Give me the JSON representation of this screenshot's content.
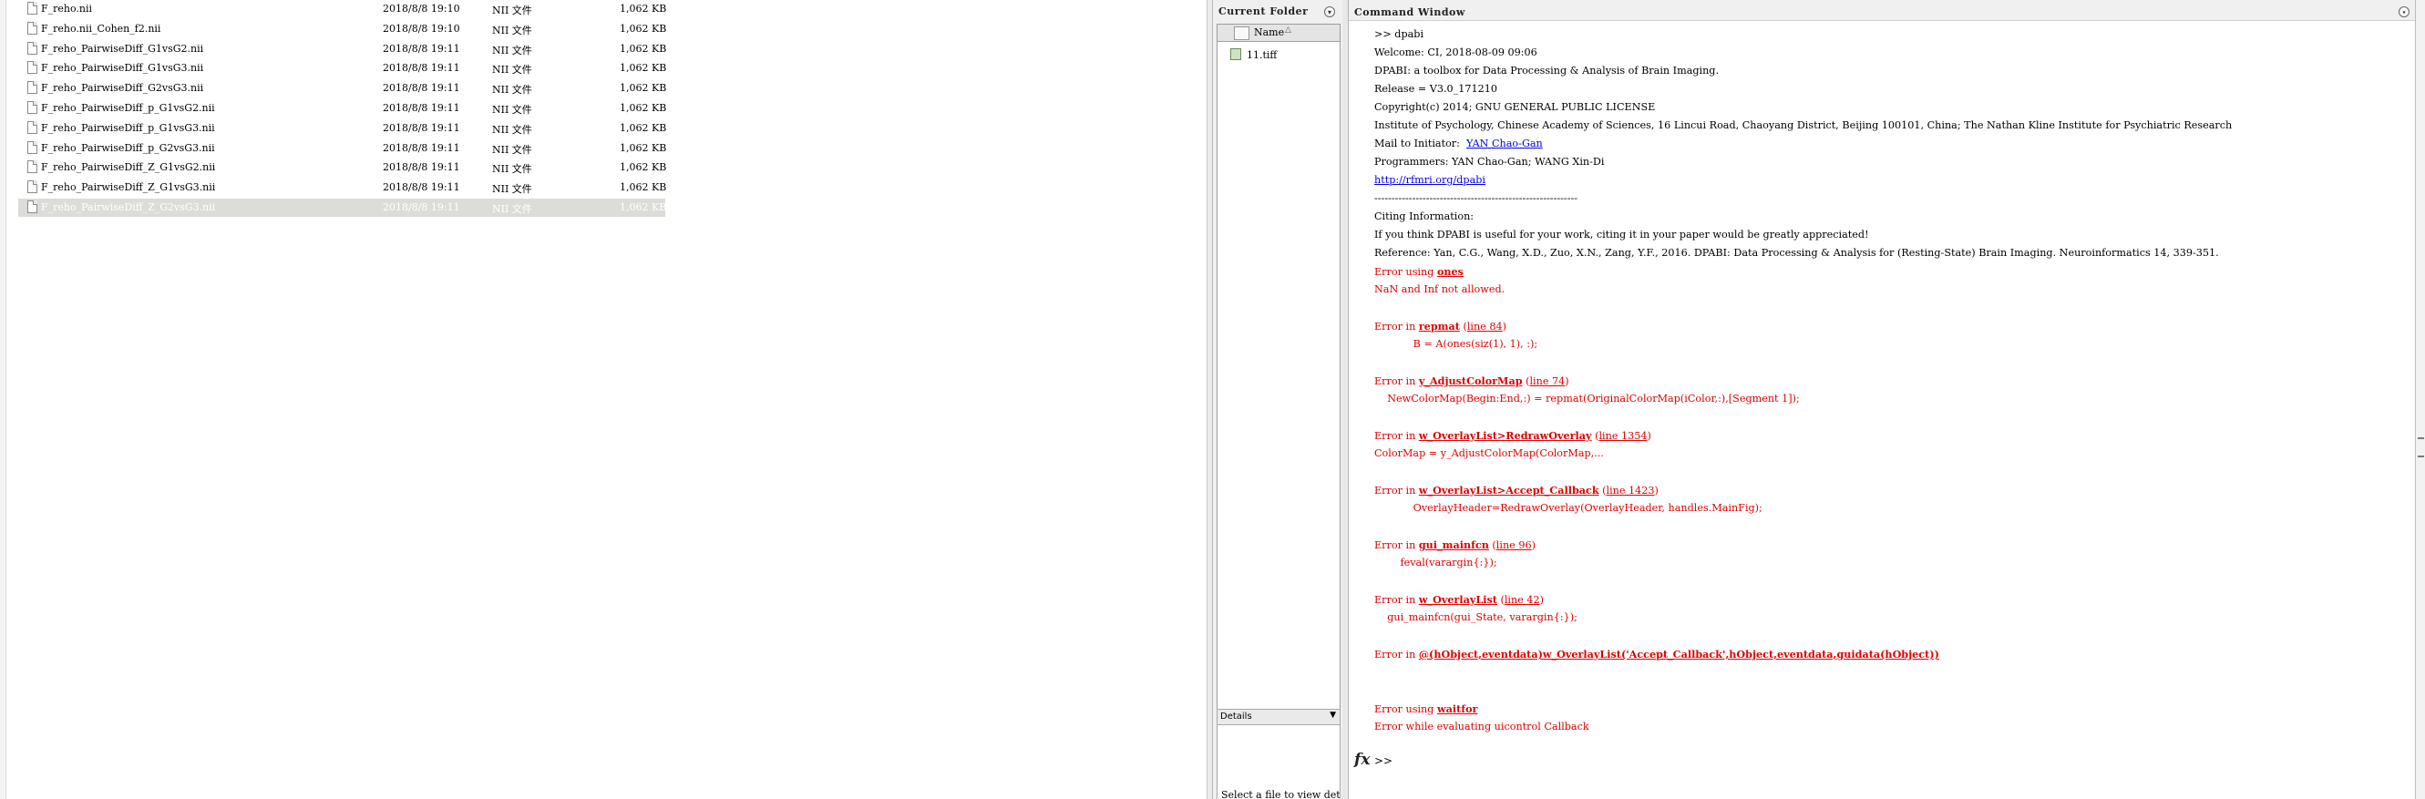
{
  "explorer": {
    "files": [
      {
        "name": "F_reho.nii",
        "date": "2018/8/8 19:10",
        "type": "NII 文件",
        "size": "1,062 KB",
        "selected": false
      },
      {
        "name": "F_reho.nii_Cohen_f2.nii",
        "date": "2018/8/8 19:10",
        "type": "NII 文件",
        "size": "1,062 KB",
        "selected": false
      },
      {
        "name": "F_reho_PairwiseDiff_G1vsG2.nii",
        "date": "2018/8/8 19:11",
        "type": "NII 文件",
        "size": "1,062 KB",
        "selected": false
      },
      {
        "name": "F_reho_PairwiseDiff_G1vsG3.nii",
        "date": "2018/8/8 19:11",
        "type": "NII 文件",
        "size": "1,062 KB",
        "selected": false
      },
      {
        "name": "F_reho_PairwiseDiff_G2vsG3.nii",
        "date": "2018/8/8 19:11",
        "type": "NII 文件",
        "size": "1,062 KB",
        "selected": false
      },
      {
        "name": "F_reho_PairwiseDiff_p_G1vsG2.nii",
        "date": "2018/8/8 19:11",
        "type": "NII 文件",
        "size": "1,062 KB",
        "selected": false
      },
      {
        "name": "F_reho_PairwiseDiff_p_G1vsG3.nii",
        "date": "2018/8/8 19:11",
        "type": "NII 文件",
        "size": "1,062 KB",
        "selected": false
      },
      {
        "name": "F_reho_PairwiseDiff_p_G2vsG3.nii",
        "date": "2018/8/8 19:11",
        "type": "NII 文件",
        "size": "1,062 KB",
        "selected": false
      },
      {
        "name": "F_reho_PairwiseDiff_Z_G1vsG2.nii",
        "date": "2018/8/8 19:11",
        "type": "NII 文件",
        "size": "1,062 KB",
        "selected": false
      },
      {
        "name": "F_reho_PairwiseDiff_Z_G1vsG3.nii",
        "date": "2018/8/8 19:11",
        "type": "NII 文件",
        "size": "1,062 KB",
        "selected": false
      },
      {
        "name": "F_reho_PairwiseDiff_Z_G2vsG3.nii",
        "date": "2018/8/8 19:11",
        "type": "NII 文件",
        "size": "1,062 KB",
        "selected": true
      }
    ]
  },
  "current_folder": {
    "title": "Current Folder",
    "menu_icon": "circle-down-arrow-icon",
    "column_name": "Name",
    "sort_indicator": "△",
    "files": [
      {
        "name": "11.tiff",
        "icon": "image-file-icon"
      }
    ],
    "details_label": "Details",
    "details_hint": "Select a file to view details"
  },
  "command_window": {
    "title": "Command Window",
    "menu_icon": "circle-down-arrow-icon",
    "lines": [
      {
        "kind": "normal",
        "parts": [
          {
            "t": ">> dpabi"
          }
        ]
      },
      {
        "kind": "normal",
        "parts": [
          {
            "t": "Welcome: CI, 2018-08-09 09:06"
          }
        ]
      },
      {
        "kind": "normal",
        "parts": [
          {
            "t": "DPABI: a toolbox for Data Processing & Analysis of Brain Imaging."
          }
        ]
      },
      {
        "kind": "normal",
        "parts": [
          {
            "t": "Release = V3.0_171210"
          }
        ]
      },
      {
        "kind": "normal",
        "parts": [
          {
            "t": "Copyright(c) 2014; GNU GENERAL PUBLIC LICENSE"
          }
        ]
      },
      {
        "kind": "normal",
        "parts": [
          {
            "t": "Institute of Psychology, Chinese Academy of Sciences, 16 Lincui Road, Chaoyang District, Beijing 100101, China; The Nathan Kline Institute for Psychiatric Research"
          }
        ]
      },
      {
        "kind": "normal",
        "parts": [
          {
            "t": "Mail to Initiator:  "
          },
          {
            "t": "YAN Chao-Gan",
            "style": "lnk"
          }
        ]
      },
      {
        "kind": "normal",
        "parts": [
          {
            "t": "Programmers: YAN Chao-Gan; WANG Xin-Di"
          }
        ]
      },
      {
        "kind": "normal",
        "parts": [
          {
            "t": "http://rfmri.org/dpabi",
            "style": "lnk"
          }
        ]
      },
      {
        "kind": "normal",
        "parts": [
          {
            "t": "-----------------------------------------------------------"
          }
        ]
      },
      {
        "kind": "normal",
        "parts": [
          {
            "t": "Citing Information:"
          }
        ]
      },
      {
        "kind": "normal",
        "parts": [
          {
            "t": "If you think DPABI is useful for your work, citing it in your paper would be greatly appreciated!"
          }
        ]
      },
      {
        "kind": "normal",
        "parts": [
          {
            "t": "Reference: Yan, C.G., Wang, X.D., Zuo, X.N., Zang, Y.F., 2016. DPABI: Data Processing & Analysis for (Resting-State) Brain Imaging. Neuroinformatics 14, 339-351."
          }
        ]
      },
      {
        "kind": "err",
        "parts": [
          {
            "t": "Error using "
          },
          {
            "t": "ones",
            "style": "elink"
          }
        ]
      },
      {
        "kind": "err",
        "parts": [
          {
            "t": "NaN and Inf not allowed."
          }
        ]
      },
      {
        "kind": "err",
        "parts": [
          {
            "t": ""
          }
        ]
      },
      {
        "kind": "err",
        "parts": [
          {
            "t": "Error in "
          },
          {
            "t": "repmat",
            "style": "elink"
          },
          {
            "t": " ("
          },
          {
            "t": "line 84",
            "style": "eline"
          },
          {
            "t": ")"
          }
        ]
      },
      {
        "kind": "err",
        "parts": [
          {
            "t": "            B = A(ones(siz(1), 1), :);"
          }
        ]
      },
      {
        "kind": "err",
        "parts": [
          {
            "t": ""
          }
        ]
      },
      {
        "kind": "err",
        "parts": [
          {
            "t": "Error in "
          },
          {
            "t": "y_AdjustColorMap",
            "style": "elink"
          },
          {
            "t": " ("
          },
          {
            "t": "line 74",
            "style": "eline"
          },
          {
            "t": ")"
          }
        ]
      },
      {
        "kind": "err",
        "parts": [
          {
            "t": "    NewColorMap(Begin:End,:) = repmat(OriginalColorMap(iColor,:),[Segment 1]);"
          }
        ]
      },
      {
        "kind": "err",
        "parts": [
          {
            "t": ""
          }
        ]
      },
      {
        "kind": "err",
        "parts": [
          {
            "t": "Error in "
          },
          {
            "t": "w_OverlayList>RedrawOverlay",
            "style": "elink"
          },
          {
            "t": " ("
          },
          {
            "t": "line 1354",
            "style": "eline"
          },
          {
            "t": ")"
          }
        ]
      },
      {
        "kind": "err",
        "parts": [
          {
            "t": "ColorMap = y_AdjustColorMap(ColorMap,..."
          }
        ]
      },
      {
        "kind": "err",
        "parts": [
          {
            "t": ""
          }
        ]
      },
      {
        "kind": "err",
        "parts": [
          {
            "t": "Error in "
          },
          {
            "t": "w_OverlayList>Accept_Callback",
            "style": "elink"
          },
          {
            "t": " ("
          },
          {
            "t": "line 1423",
            "style": "eline"
          },
          {
            "t": ")"
          }
        ]
      },
      {
        "kind": "err",
        "parts": [
          {
            "t": "            OverlayHeader=RedrawOverlay(OverlayHeader, handles.MainFig);"
          }
        ]
      },
      {
        "kind": "err",
        "parts": [
          {
            "t": ""
          }
        ]
      },
      {
        "kind": "err",
        "parts": [
          {
            "t": "Error in "
          },
          {
            "t": "gui_mainfcn",
            "style": "elink"
          },
          {
            "t": " ("
          },
          {
            "t": "line 96",
            "style": "eline"
          },
          {
            "t": ")"
          }
        ]
      },
      {
        "kind": "err",
        "parts": [
          {
            "t": "        feval(varargin{:});"
          }
        ]
      },
      {
        "kind": "err",
        "parts": [
          {
            "t": ""
          }
        ]
      },
      {
        "kind": "err",
        "parts": [
          {
            "t": "Error in "
          },
          {
            "t": "w_OverlayList",
            "style": "elink"
          },
          {
            "t": " ("
          },
          {
            "t": "line 42",
            "style": "eline"
          },
          {
            "t": ")"
          }
        ]
      },
      {
        "kind": "err",
        "parts": [
          {
            "t": "    gui_mainfcn(gui_State, varargin{:});"
          }
        ]
      },
      {
        "kind": "err",
        "parts": [
          {
            "t": ""
          }
        ]
      },
      {
        "kind": "err",
        "parts": [
          {
            "t": "Error in "
          },
          {
            "t": "@(hObject,eventdata)w_OverlayList('Accept_Callback',hObject,eventdata,guidata(hObject))",
            "style": "elink"
          }
        ]
      },
      {
        "kind": "err",
        "parts": [
          {
            "t": ""
          }
        ]
      },
      {
        "kind": "err",
        "parts": [
          {
            "t": ""
          }
        ]
      },
      {
        "kind": "err",
        "parts": [
          {
            "t": "Error using "
          },
          {
            "t": "waitfor",
            "style": "elink"
          }
        ]
      },
      {
        "kind": "err",
        "parts": [
          {
            "t": "Error while evaluating uicontrol Callback"
          }
        ]
      }
    ],
    "prompt_symbol": ">>",
    "prompt_value": "",
    "fx_icon": "function-fx-icon"
  },
  "colors": {
    "error_text": "#e00000",
    "link_text": "#0000ee",
    "selected_row": "#dcdcd8",
    "panel_bg": "#f0f0f0"
  }
}
